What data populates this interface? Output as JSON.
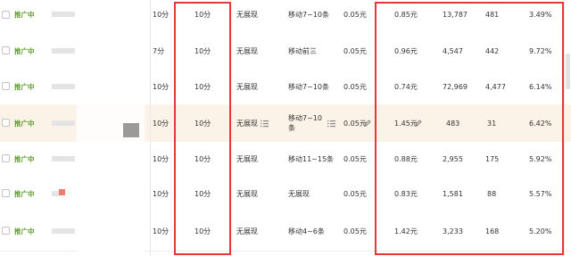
{
  "table": {
    "rows": [
      {
        "status": "推广中",
        "col_a": "10分",
        "col_b": "10分",
        "display": "无展现",
        "rank": "移动7~10条",
        "bid": "0.05元",
        "price": "0.85元",
        "impressions": "13,787",
        "clicks": "481",
        "ctr": "3.49%"
      },
      {
        "status": "推广中",
        "col_a": "7分",
        "col_b": "10分",
        "display": "无展现",
        "rank": "移动前三",
        "bid": "0.05元",
        "price": "0.96元",
        "impressions": "4,547",
        "clicks": "442",
        "ctr": "9.72%"
      },
      {
        "status": "推广中",
        "col_a": "10分",
        "col_b": "10分",
        "display": "无展现",
        "rank": "移动7~10条",
        "bid": "0.05元",
        "price": "0.74元",
        "impressions": "72,969",
        "clicks": "4,477",
        "ctr": "6.14%"
      },
      {
        "status": "推广中",
        "col_a": "10分",
        "col_b": "10分",
        "display": "无展现",
        "rank": "移动7~10条",
        "bid": "0.05元",
        "price": "1.45元",
        "impressions": "483",
        "clicks": "31",
        "ctr": "6.42%"
      },
      {
        "status": "推广中",
        "col_a": "10分",
        "col_b": "10分",
        "display": "无展现",
        "rank": "移动11~15条",
        "bid": "0.05元",
        "price": "0.88元",
        "impressions": "2,955",
        "clicks": "175",
        "ctr": "5.92%"
      },
      {
        "status": "推广中",
        "col_a": "10分",
        "col_b": "10分",
        "display": "无展现",
        "rank": "无展现",
        "bid": "0.05元",
        "price": "0.83元",
        "impressions": "1,581",
        "clicks": "88",
        "ctr": "5.57%"
      },
      {
        "status": "推广中",
        "col_a": "10分",
        "col_b": "10分",
        "display": "无展现",
        "rank": "移动4~6条",
        "bid": "0.05元",
        "price": "1.42元",
        "impressions": "3,233",
        "clicks": "168",
        "ctr": "5.20%"
      }
    ]
  },
  "icons": {
    "edit": "pencil-icon",
    "list": "list-icon"
  },
  "colors": {
    "status_green": "#5e9c2c",
    "highlight_box": "#e53935",
    "highlight_row": "#fbf2e8"
  }
}
